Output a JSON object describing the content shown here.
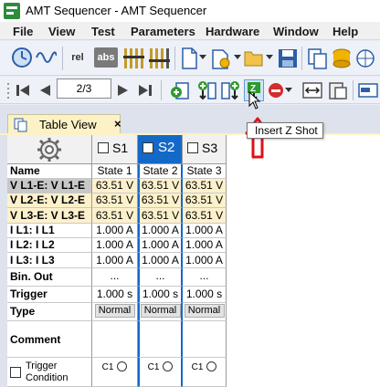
{
  "window": {
    "title": "AMT Sequencer - AMT Sequencer"
  },
  "menu": [
    "File",
    "View",
    "Test",
    "Parameters",
    "Hardware",
    "Window",
    "Help"
  ],
  "toolbar": {
    "rel_label": "rel",
    "abs_label": "abs",
    "step_field": "2/3",
    "tooltip": "Insert Z Shot"
  },
  "doc_tab": {
    "label": "Table View",
    "close": "×"
  },
  "table": {
    "columns": [
      {
        "label": "S1",
        "checked": false,
        "selected": false
      },
      {
        "label": "S2",
        "checked": false,
        "selected": true
      },
      {
        "label": "S3",
        "checked": false,
        "selected": false
      }
    ],
    "rows": {
      "name": {
        "label": "Name",
        "values": [
          "State 1",
          "State 2",
          "State 3"
        ]
      },
      "v1": {
        "label": "V L1-E: V L1-E",
        "values": [
          "63.51 V",
          "63.51 V",
          "63.51 V"
        ]
      },
      "v2": {
        "label": "V L2-E: V L2-E",
        "values": [
          "63.51 V",
          "63.51 V",
          "63.51 V"
        ]
      },
      "v3": {
        "label": "V L3-E: V L3-E",
        "values": [
          "63.51 V",
          "63.51 V",
          "63.51 V"
        ]
      },
      "i1": {
        "label": "I L1: I L1",
        "values": [
          "1.000 A",
          "1.000 A",
          "1.000 A"
        ]
      },
      "i2": {
        "label": "I L2: I L2",
        "values": [
          "1.000 A",
          "1.000 A",
          "1.000 A"
        ]
      },
      "i3": {
        "label": "I L3: I L3",
        "values": [
          "1.000 A",
          "1.000 A",
          "1.000 A"
        ]
      },
      "binout": {
        "label": "Bin. Out",
        "values": [
          "...",
          "...",
          "..."
        ]
      },
      "trigger": {
        "label": "Trigger",
        "values": [
          "1.000 s",
          "1.000 s",
          "1.000 s"
        ]
      },
      "type": {
        "label": "Type",
        "values": [
          "Normal",
          "Normal",
          "Normal"
        ]
      },
      "comment": {
        "label": "Comment",
        "values": [
          "",
          "",
          ""
        ]
      },
      "trigcond": {
        "label": "Trigger Condition",
        "values": [
          "C1",
          "C1",
          "C1"
        ]
      }
    }
  },
  "colors": {
    "accent": "#1469c8",
    "voltage_row_bg": "#fdf1cc",
    "tab_bg": "#fdf2c5",
    "arrow": "#e0101a"
  }
}
